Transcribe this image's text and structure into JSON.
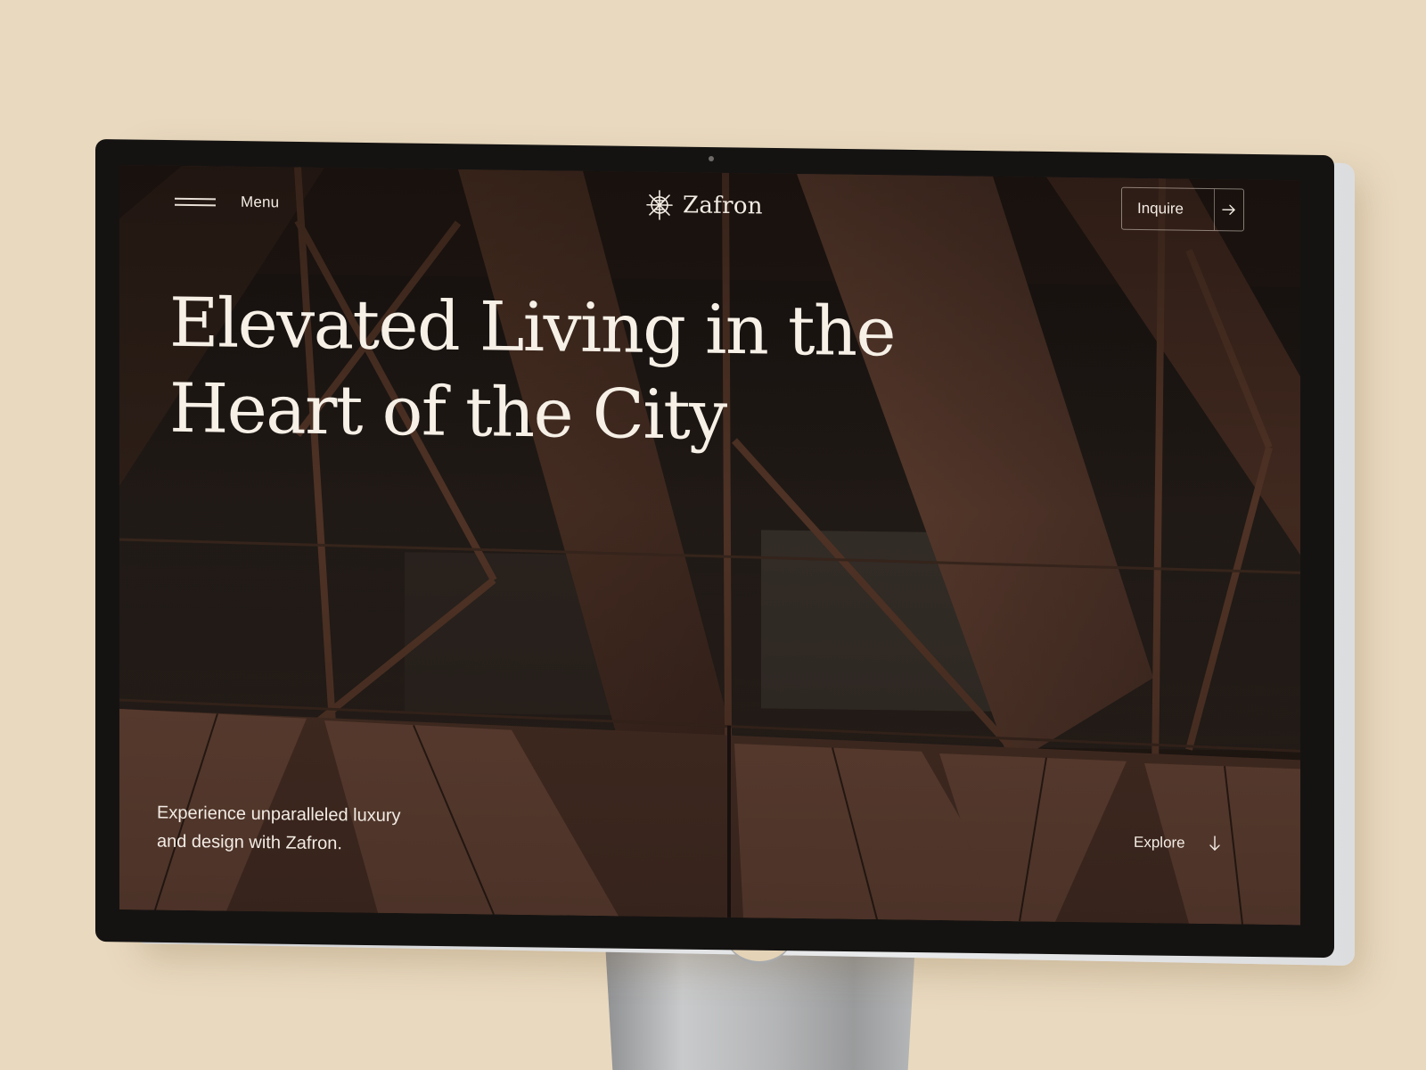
{
  "nav": {
    "menu_label": "Menu",
    "menu_icon": "hamburger-icon",
    "brand_name": "Zafron",
    "brand_icon": "zafron-logo-icon",
    "inquire_label": "Inquire",
    "inquire_icon": "arrow-right-icon"
  },
  "hero": {
    "headline_line1": "Elevated Living in the",
    "headline_line2": "Heart of the City",
    "tagline_line1": "Experience unparalleled luxury",
    "tagline_line2": "and design with Zafron.",
    "explore_label": "Explore",
    "explore_icon": "arrow-down-icon",
    "background": "wood-lattice-building-facade-photo"
  },
  "colors": {
    "page_background": "#e9d9bf",
    "hero_text": "#f6f0e7",
    "hero_base": "#2c1f18"
  }
}
